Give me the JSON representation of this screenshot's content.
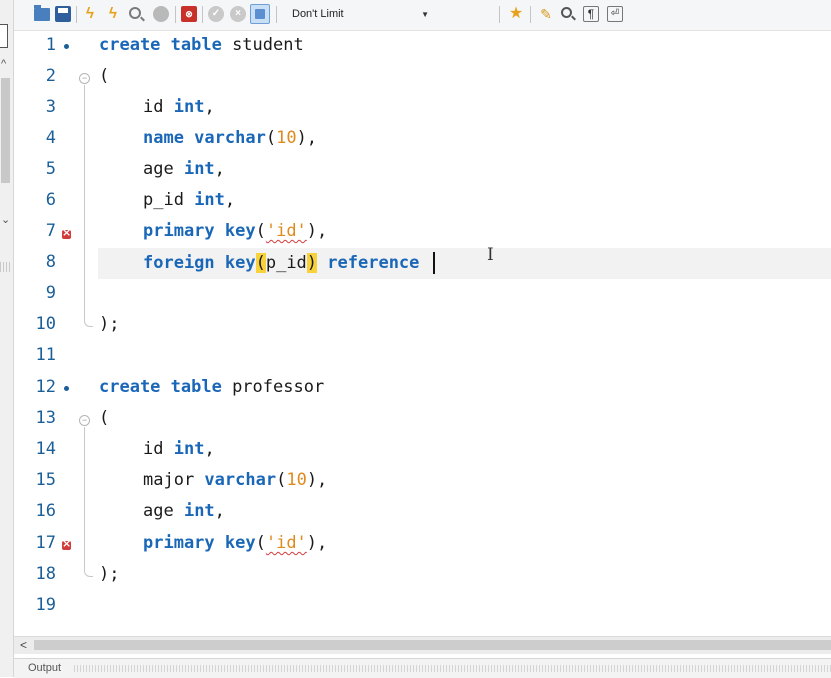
{
  "toolbar": {
    "limit_value": "Don't Limit",
    "icons": [
      "open-folder-icon",
      "save-icon",
      "execute-icon",
      "execute-current-icon",
      "explain-icon",
      "stop-icon",
      "toggle-continue-icon",
      "commit-icon",
      "rollback-icon",
      "autocommit-icon",
      "limit-dropdown",
      "bookmark-icon",
      "beautify-icon",
      "find-icon",
      "invisible-chars-icon",
      "word-wrap-icon"
    ]
  },
  "editor": {
    "lines": [
      {
        "num": "1"
      },
      {
        "num": "2"
      },
      {
        "num": "3"
      },
      {
        "num": "4"
      },
      {
        "num": "5"
      },
      {
        "num": "6"
      },
      {
        "num": "7"
      },
      {
        "num": "8"
      },
      {
        "num": "9"
      },
      {
        "num": "10"
      },
      {
        "num": "11"
      },
      {
        "num": "12"
      },
      {
        "num": "13"
      },
      {
        "num": "14"
      },
      {
        "num": "15"
      },
      {
        "num": "16"
      },
      {
        "num": "17"
      },
      {
        "num": "18"
      },
      {
        "num": "19"
      }
    ],
    "code": {
      "l1_kw": "create table",
      "l1_name": " student",
      "l2": "(",
      "l3_id": "id ",
      "l3_type": "int",
      "l3_end": ",",
      "l4_kw": "name varchar",
      "l4_open": "(",
      "l4_num": "10",
      "l4_end": "),",
      "l5_id": "age ",
      "l5_type": "int",
      "l5_end": ",",
      "l6_id": "p_id ",
      "l6_type": "int",
      "l6_end": ",",
      "l7_kw": "primary key",
      "l7_open": "(",
      "l7_str": "'id'",
      "l7_end": "),",
      "l8_kw": "foreign key",
      "l8_open": "(",
      "l8_id": "p_id",
      "l8_close": ")",
      "l8_kw2": " reference ",
      "l10": ");",
      "l12_kw": "create table",
      "l12_name": " professor",
      "l13": "(",
      "l14_id": "id ",
      "l14_type": "int",
      "l14_end": ",",
      "l15_id": "major ",
      "l15_type": "varchar",
      "l15_open": "(",
      "l15_num": "10",
      "l15_end": "),",
      "l16_id": "age ",
      "l16_type": "int",
      "l16_end": ",",
      "l17_kw": "primary key",
      "l17_open": "(",
      "l17_str": "'id'",
      "l17_end": "),",
      "l18": ");"
    }
  },
  "output": {
    "label": "Output"
  },
  "colors": {
    "keyword": "#1a67b8",
    "number": "#e08a1e",
    "error": "#d23b3b",
    "bracket_highlight": "#f7d23a"
  }
}
